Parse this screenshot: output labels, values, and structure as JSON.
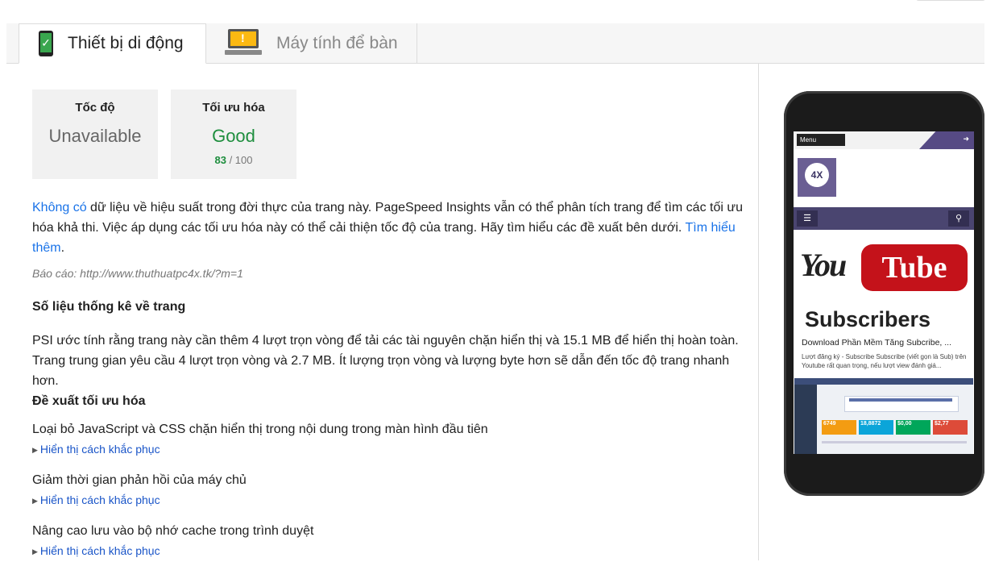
{
  "tabs": [
    {
      "label": "Thiết bị di động",
      "icon": "mobile-icon",
      "active": true
    },
    {
      "label": "Máy tính để bàn",
      "icon": "desktop-icon",
      "active": false
    }
  ],
  "cards": {
    "speed": {
      "title": "Tốc độ",
      "value": "Unavailable",
      "color": "#666666"
    },
    "optimization": {
      "title": "Tối ưu hóa",
      "value": "Good",
      "score": "83",
      "max": "/ 100",
      "color": "#1e8e3e"
    }
  },
  "intro": {
    "link1": "Không có",
    "text": " dữ liệu về hiệu suất trong đời thực của trang này. PageSpeed Insights vẫn có thể phân tích trang để tìm các tối ưu hóa khả thi. Việc áp dụng các tối ưu hóa này có thể cải thiện tốc độ của trang. Hãy tìm hiểu các đề xuất bên dưới. ",
    "link2": "Tìm hiểu thêm",
    "tail": "."
  },
  "report": "Báo cáo: http://www.thuthuatpc4x.tk/?m=1",
  "stats": {
    "heading": "Số liệu thống kê về trang",
    "text": "PSI ước tính rằng trang này cần thêm 4 lượt trọn vòng để tải các tài nguyên chặn hiển thị và 15.1 MB để hiển thị hoàn toàn. Trang trung gian yêu cầu 4 lượt trọn vòng và 2.7 MB. Ít lượng trọn vòng và lượng byte hơn sẽ dẫn đến tốc độ trang nhanh hơn."
  },
  "suggestions": {
    "heading": "Đề xuất tối ưu hóa",
    "items": [
      {
        "title": "Loại bỏ JavaScript và CSS chặn hiển thị trong nội dung trong màn hình đầu tiên",
        "fix": "Hiển thị cách khắc phục"
      },
      {
        "title": "Giảm thời gian phản hồi của máy chủ",
        "fix": "Hiển thị cách khắc phục"
      },
      {
        "title": "Nâng cao lưu vào bộ nhớ cache trong trình duyệt",
        "fix": "Hiển thị cách khắc phục"
      }
    ]
  },
  "preview": {
    "menu": "Menu",
    "logo": "4X",
    "banner_you": "You",
    "banner_tube": "Tube",
    "banner_sub": "Subscribers",
    "post_title": "Download Phần Mềm Tăng Subcribe, ...",
    "post_desc": "Lượt đăng ký - Subscribe Subscribe (viết gọn là Sub) trên Youtube rất quan trọng, nếu lượt view đánh giá...",
    "tiles": [
      {
        "value": "6749",
        "color": "#f39c12"
      },
      {
        "value": "18,8872",
        "color": "#0ba5d9"
      },
      {
        "value": "$0,00",
        "color": "#00a65a"
      },
      {
        "value": "$2,77",
        "color": "#dd4b39"
      }
    ]
  }
}
